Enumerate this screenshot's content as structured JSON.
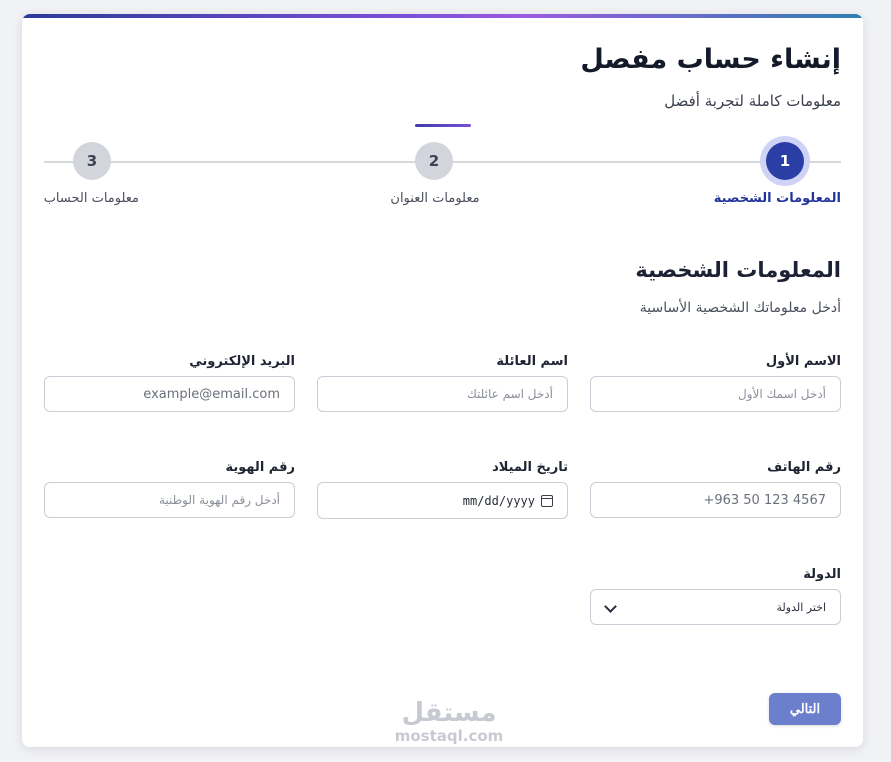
{
  "header": {
    "title": "إنشاء حساب مفصل",
    "subtitle": "معلومات كاملة لتجربة أفضل"
  },
  "stepper": {
    "steps": [
      {
        "number": "1",
        "label": "المعلومات الشخصية",
        "active": true
      },
      {
        "number": "2",
        "label": "معلومات العنوان",
        "active": false
      },
      {
        "number": "3",
        "label": "معلومات الحساب",
        "active": false
      }
    ]
  },
  "section": {
    "title": "المعلومات الشخصية",
    "subtitle": "أدخل معلوماتك الشخصية الأساسية"
  },
  "fields": {
    "first_name": {
      "label": "الاسم الأول",
      "placeholder": "أدخل اسمك الأول"
    },
    "last_name": {
      "label": "اسم العائلة",
      "placeholder": "أدخل اسم عائلتك"
    },
    "email": {
      "label": "البريد الإلكتروني",
      "placeholder": "example@email.com"
    },
    "phone": {
      "label": "رقم الهاتف",
      "placeholder": "+963 50 123 4567"
    },
    "birth_date": {
      "label": "تاريخ الميلاد",
      "placeholder": "mm/dd/yyyy"
    },
    "id_number": {
      "label": "رقم الهوية",
      "placeholder": "أدخل رقم الهوية الوطنية"
    },
    "country": {
      "label": "الدولة",
      "selected": "اختر الدولة"
    }
  },
  "actions": {
    "next_label": "التالي"
  },
  "watermark": {
    "arabic": "مستقل",
    "latin": "mostaql.com"
  },
  "colors": {
    "accent": "#2a3ea6",
    "button": "#6c7fcc",
    "step_idle": "#d3d5dc"
  }
}
